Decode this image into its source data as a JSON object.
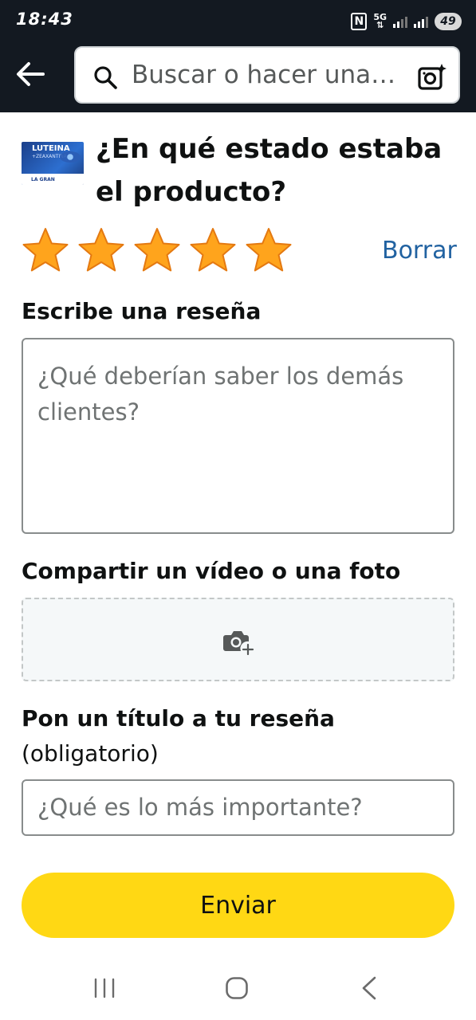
{
  "status_bar": {
    "time": "18:43",
    "network": "5G",
    "battery": "49",
    "icons": [
      "nfc-icon",
      "signal-icon",
      "battery-icon"
    ]
  },
  "header": {
    "back_icon": "back-arrow-icon",
    "search_placeholder": "Buscar o hacer una…",
    "search_icon": "search-icon",
    "camera_icon": "camera-plus-icon"
  },
  "product": {
    "thumb_brand": "LUTEINA",
    "thumb_sub": "+ZEAXANTINA",
    "thumb_band": "LA GRAN"
  },
  "question": "¿En qué estado estaba el producto?",
  "rating": {
    "value": 5,
    "max": 5,
    "clear_label": "Borrar",
    "star_color": "#ffa41c"
  },
  "review": {
    "label": "Escribe una reseña",
    "placeholder": "¿Qué deberían saber los demás clientes?"
  },
  "media": {
    "label": "Compartir un vídeo o una foto",
    "icon": "camera-add-icon"
  },
  "title_field": {
    "label": "Pon un título a tu reseña",
    "required_note": "(obligatorio)",
    "placeholder": "¿Qué es lo más importante?"
  },
  "submit": {
    "label": "Enviar",
    "color": "#ffd814"
  },
  "navbar": {
    "icons": [
      "recent-apps-icon",
      "home-icon",
      "nav-back-icon"
    ]
  }
}
